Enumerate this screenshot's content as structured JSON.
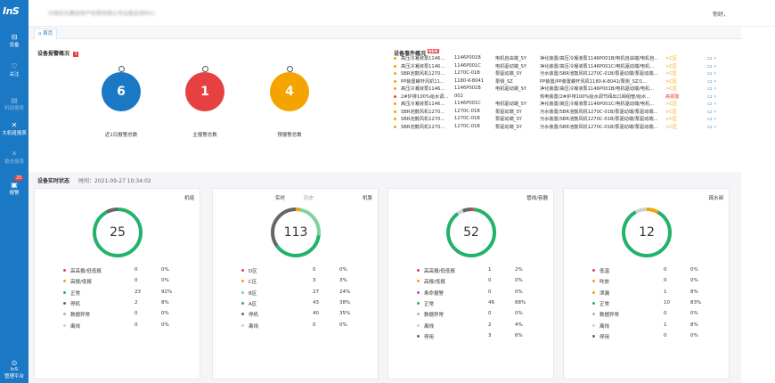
{
  "colors": {
    "sidebar": "#1b78c4",
    "green": "#22b26a",
    "red": "#e64040",
    "orange": "#f5a300",
    "blue": "#1b78c4",
    "gray": "#666666",
    "purple": "#b44fd4",
    "lightgreen": "#7fd3a0",
    "lightgray": "#b0b0b0"
  },
  "sidebar": {
    "logo": "InS",
    "items": [
      {
        "label": "设备",
        "icon": "device-icon",
        "glyph": "⊟",
        "dim": false
      },
      {
        "label": "关注",
        "icon": "heart-icon",
        "glyph": "♡",
        "dim": false
      },
      {
        "label": "机组报表",
        "icon": "report-icon",
        "glyph": "▤",
        "dim": true
      },
      {
        "label": "大机组报表",
        "icon": "crossed-tools-icon",
        "glyph": "✕",
        "dim": false
      },
      {
        "label": "稳态报表",
        "icon": "crossed-tools-icon",
        "glyph": "✕",
        "dim": true
      },
      {
        "label": "报警",
        "icon": "alarm-icon",
        "glyph": "▣",
        "dim": false,
        "badge": "25"
      }
    ],
    "bottom": {
      "label": "InS\n管理平台",
      "icon": "platform-icon",
      "glyph": "⊙"
    }
  },
  "topbar": {
    "title": "中国石化集团资产经营有限公司设备监测中心",
    "greeting": "你好，",
    "user": ""
  },
  "tabs": [
    {
      "label": "首页",
      "icon": "home-icon"
    }
  ],
  "alarm_overview": {
    "title": "设备报警概况",
    "bubbles": [
      {
        "value": "6",
        "label": "近1日报警总数",
        "color": "#1b78c4"
      },
      {
        "value": "1",
        "label": "主报警总数",
        "color": "#e64040"
      },
      {
        "value": "4",
        "label": "预报警总数",
        "color": "#f5a300"
      }
    ]
  },
  "events": {
    "title": "设备事件概况",
    "rows": [
      {
        "dot": "#f5a300",
        "name": "高压冷凝液泵1146...",
        "code": "1146P001B",
        "type": "电机自由端_SY",
        "path": "净化装置/高压冷凝液泵1146P001B/电机自由端/电机自...",
        "level": ">C区",
        "level_color": "#f5a300"
      },
      {
        "dot": "#f5a300",
        "name": "高压冷凝液泵1146...",
        "code": "1146P001C",
        "type": "电机驱动端_SY",
        "path": "净化装置/高压冷凝液泵1146P001C/电机驱动端/电机...",
        "level": ">C区",
        "level_color": "#f5a300"
      },
      {
        "dot": "#f5a300",
        "name": "SBR池鼓风机1270...",
        "code": "1270C-01B",
        "type": "泵驱动端_SY",
        "path": "污水装置/SBR池鼓风机1270C-01B/泵驱动端/泵驱动端...",
        "level": ">C区",
        "level_color": "#f5a300"
      },
      {
        "dot": "#f5a300",
        "name": "PP装置螺杆风机11...",
        "code": "1180-K-8041",
        "type": "泵侧_SZ",
        "path": "PP装置/PP装置螺杆风机1180-K-8041/泵侧_SZ/1...",
        "level": ">C区",
        "level_color": "#f5a300"
      },
      {
        "dot": "#f5a300",
        "name": "高压冷凝液泵1146...",
        "code": "1146P001B",
        "type": "电机驱动端_SY",
        "path": "净化装置/高压冷凝液泵1146P001B/电机驱动端/电机...",
        "level": ">C区",
        "level_color": "#f5a300"
      },
      {
        "dot": "#e64040",
        "name": "2#炉排100%给水调...",
        "code": "002",
        "type": "",
        "path": "热电装置/2#炉排100%给水调节阀出口阀组管/给水...",
        "level": "高报警",
        "level_color": "#e64040"
      },
      {
        "dot": "#f5a300",
        "name": "高压冷凝液泵1146...",
        "code": "1146P001C",
        "type": "电机驱动端_SY",
        "path": "净化装置/高压冷凝液泵1146P001C/电机驱动端/电机...",
        "level": ">C区",
        "level_color": "#f5a300"
      },
      {
        "dot": "#f5a300",
        "name": "SBR池鼓风机1270...",
        "code": "1270C-01B",
        "type": "泵驱动端_SY",
        "path": "污水装置/SBR池鼓风机1270C-01B/泵驱动端/泵驱动端...",
        "level": ">C区",
        "level_color": "#f5a300"
      },
      {
        "dot": "#f5a300",
        "name": "SBR池鼓风机1270...",
        "code": "1270C-01B",
        "type": "泵驱动端_SY",
        "path": "污水装置/SBR池鼓风机1270C-01B/泵驱动端/泵驱动端...",
        "level": ">C区",
        "level_color": "#f5a300"
      },
      {
        "dot": "#f5a300",
        "name": "SBR池鼓风机1270...",
        "code": "1270C-01B",
        "type": "泵驱动端_SY",
        "path": "污水装置/SBR池鼓风机1270C-01B/泵驱动端/泵驱动端...",
        "level": ">C区",
        "level_color": "#f5a300"
      }
    ]
  },
  "status": {
    "title": "设备实时状态",
    "time": "时间：2021-09-27 10:34:02",
    "cards": [
      {
        "tag": "机组",
        "tabs": [],
        "total": "25",
        "rows": [
          {
            "name": "高高报/低低报",
            "count": "0",
            "pct": "0%",
            "color": "#e64040"
          },
          {
            "name": "高报/低报",
            "count": "0",
            "pct": "0%",
            "color": "#f5a300"
          },
          {
            "name": "正常",
            "count": "23",
            "pct": "92%",
            "color": "#22b26a"
          },
          {
            "name": "停机",
            "count": "2",
            "pct": "8%",
            "color": "#666666"
          },
          {
            "name": "数据异常",
            "count": "0",
            "pct": "0%",
            "color": "#b0b0b0"
          },
          {
            "name": "离线",
            "count": "0",
            "pct": "0%",
            "color": "#d0d0d0"
          }
        ],
        "ring": [
          {
            "frac": 0.92,
            "color": "#22b26a"
          },
          {
            "frac": 0.08,
            "color": "#666666"
          }
        ]
      },
      {
        "tag": "机泵",
        "tabs": [
          "实时",
          "历史"
        ],
        "total": "113",
        "rows": [
          {
            "name": "D区",
            "count": "0",
            "pct": "0%",
            "color": "#e64040"
          },
          {
            "name": "C区",
            "count": "3",
            "pct": "3%",
            "color": "#f5a300"
          },
          {
            "name": "B区",
            "count": "27",
            "pct": "24%",
            "color": "#7fd3a0"
          },
          {
            "name": "A区",
            "count": "43",
            "pct": "38%",
            "color": "#22b26a"
          },
          {
            "name": "停机",
            "count": "40",
            "pct": "35%",
            "color": "#666666"
          },
          {
            "name": "离线",
            "count": "0",
            "pct": "0%",
            "color": "#d0d0d0"
          }
        ],
        "ring": [
          {
            "frac": 0.03,
            "color": "#f5a300"
          },
          {
            "frac": 0.24,
            "color": "#7fd3a0"
          },
          {
            "frac": 0.38,
            "color": "#22b26a"
          },
          {
            "frac": 0.35,
            "color": "#666666"
          }
        ]
      },
      {
        "tag": "管线/容器",
        "tabs": [],
        "total": "52",
        "rows": [
          {
            "name": "高高报/低低报",
            "count": "1",
            "pct": "2%",
            "color": "#e64040"
          },
          {
            "name": "高报/低报",
            "count": "0",
            "pct": "0%",
            "color": "#f5a300"
          },
          {
            "name": "寿命报警",
            "count": "0",
            "pct": "0%",
            "color": "#b44fd4"
          },
          {
            "name": "正常",
            "count": "46",
            "pct": "88%",
            "color": "#22b26a"
          },
          {
            "name": "数据异常",
            "count": "0",
            "pct": "0%",
            "color": "#b0b0b0"
          },
          {
            "name": "离线",
            "count": "2",
            "pct": "4%",
            "color": "#d0d0d0"
          },
          {
            "name": "停用",
            "count": "3",
            "pct": "6%",
            "color": "#666666"
          }
        ],
        "ring": [
          {
            "frac": 0.02,
            "color": "#e64040"
          },
          {
            "frac": 0.88,
            "color": "#22b26a"
          },
          {
            "frac": 0.04,
            "color": "#d0d0d0"
          },
          {
            "frac": 0.06,
            "color": "#666666"
          }
        ]
      },
      {
        "tag": "疏水阀",
        "tabs": [],
        "total": "12",
        "rows": [
          {
            "name": "低温",
            "count": "0",
            "pct": "0%",
            "color": "#e64040"
          },
          {
            "name": "吹放",
            "count": "0",
            "pct": "0%",
            "color": "#f5a300"
          },
          {
            "name": "泄漏",
            "count": "1",
            "pct": "8%",
            "color": "#f5a300"
          },
          {
            "name": "正常",
            "count": "10",
            "pct": "83%",
            "color": "#22b26a"
          },
          {
            "name": "数据异常",
            "count": "0",
            "pct": "0%",
            "color": "#b0b0b0"
          },
          {
            "name": "离线",
            "count": "1",
            "pct": "8%",
            "color": "#d0d0d0"
          },
          {
            "name": "停用",
            "count": "0",
            "pct": "0%",
            "color": "#666666"
          }
        ],
        "ring": [
          {
            "frac": 0.08,
            "color": "#f5a300"
          },
          {
            "frac": 0.84,
            "color": "#22b26a"
          },
          {
            "frac": 0.08,
            "color": "#d0d0d0"
          }
        ]
      }
    ]
  }
}
